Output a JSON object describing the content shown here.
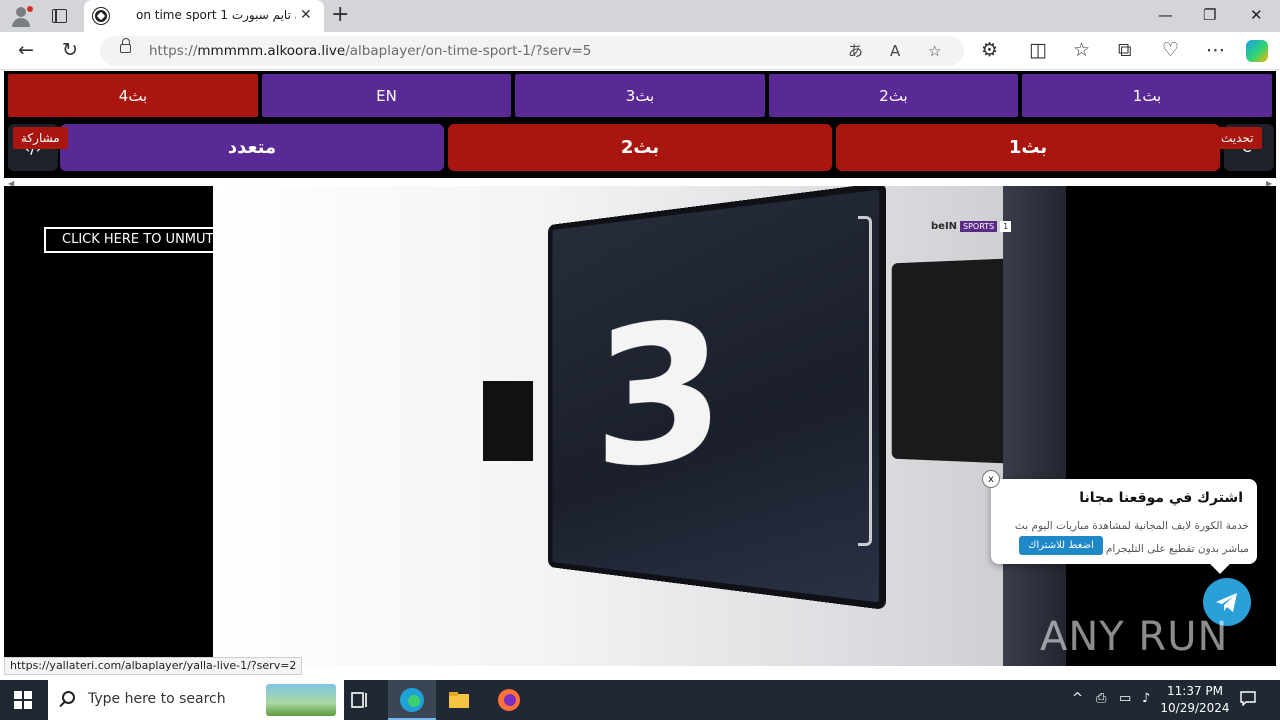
{
  "browser": {
    "tab_title": "on time sport 1 اون تايم سبورت",
    "tab_close": "✕",
    "new_tab": "+",
    "url_scheme": "https://",
    "url_host": "mmmmm.alkoora.live",
    "url_path": "/albaplayer/on-time-sport-1/?serv=5",
    "win_min": "—",
    "win_max": "❐",
    "win_close": "✕"
  },
  "servers": {
    "row1": [
      {
        "label": "بث4",
        "color": "red"
      },
      {
        "label": "EN",
        "color": "purple"
      },
      {
        "label": "بث3",
        "color": "purple"
      },
      {
        "label": "بث2",
        "color": "purple"
      },
      {
        "label": "بث1",
        "color": "purple"
      }
    ],
    "row2": [
      {
        "label": "متعدد",
        "color": "purple"
      },
      {
        "label": "بث2",
        "color": "red"
      },
      {
        "label": "بث1",
        "color": "red"
      }
    ],
    "share_label": "مشاركة",
    "refresh_label": "تحديث"
  },
  "player": {
    "unmute_label": "CLICK HERE TO UNMUTE",
    "channel_logo": {
      "brand": "beIN",
      "name": "SPORTS",
      "number": "1"
    },
    "countdown_digit": "3"
  },
  "popup": {
    "title": "اشترك في موقعنا مجانا",
    "description": "خدمة الكورة لايف المجانية لمشاهدة مباريات اليوم بث مباشر بدون تقطيع على التليجرام",
    "button_label": "اضغط للاشتراك",
    "close_label": "x"
  },
  "status_link": "https://yallateri.com/albaplayer/yalla-live-1/?serv=2",
  "watermark": "ANY RUN",
  "taskbar": {
    "search_placeholder": "Type here to search",
    "time": "11:37 PM",
    "date": "10/29/2024"
  },
  "colors": {
    "purple": "#592a95",
    "red": "#a9150f",
    "telegram": "#2a9fd8"
  }
}
